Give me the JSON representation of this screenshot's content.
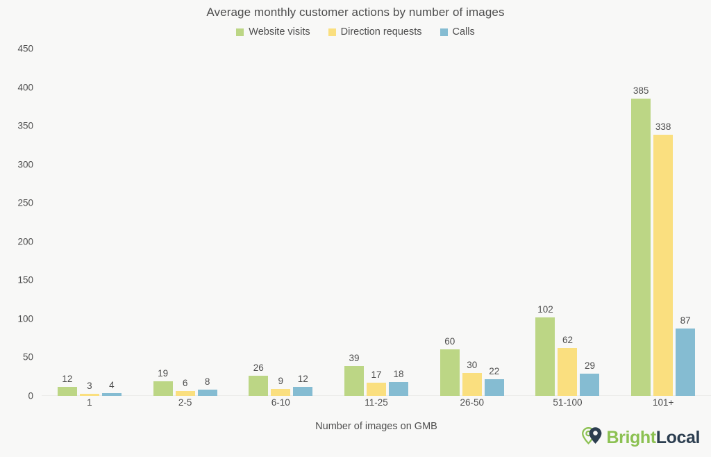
{
  "chart_data": {
    "type": "bar",
    "title": "Average monthly customer actions by number of images",
    "xlabel": "Number of images on GMB",
    "ylabel": "",
    "ylim": [
      0,
      450
    ],
    "ytick_step": 50,
    "yticks": [
      "450",
      "400",
      "350",
      "300",
      "250",
      "200",
      "150",
      "100",
      "50",
      "0"
    ],
    "grid": false,
    "legend_position": "top-center",
    "categories": [
      "1",
      "2-5",
      "6-10",
      "11-25",
      "26-50",
      "51-100",
      "101+"
    ],
    "series": [
      {
        "name": "Website visits",
        "color": "#bcd685",
        "values": [
          12,
          19,
          26,
          39,
          60,
          102,
          385
        ],
        "labels": [
          "12",
          "19",
          "26",
          "39",
          "60",
          "102",
          "385"
        ]
      },
      {
        "name": "Direction requests",
        "color": "#fadf7f",
        "values": [
          3,
          6,
          9,
          17,
          30,
          62,
          338
        ],
        "labels": [
          "3",
          "6",
          "9",
          "17",
          "30",
          "62",
          "338"
        ]
      },
      {
        "name": "Calls",
        "color": "#85bcd2",
        "values": [
          4,
          8,
          12,
          18,
          22,
          29,
          87
        ],
        "labels": [
          "4",
          "8",
          "12",
          "18",
          "22",
          "29",
          "87"
        ]
      }
    ]
  },
  "logo": {
    "bright": "Bright",
    "local": "Local",
    "pin_icon": "map-pin-icon",
    "pin_green": "#8cc152",
    "pin_navy": "#2c3e50"
  },
  "background_color": "#f8f8f7",
  "text_color": "#4d4d4d"
}
